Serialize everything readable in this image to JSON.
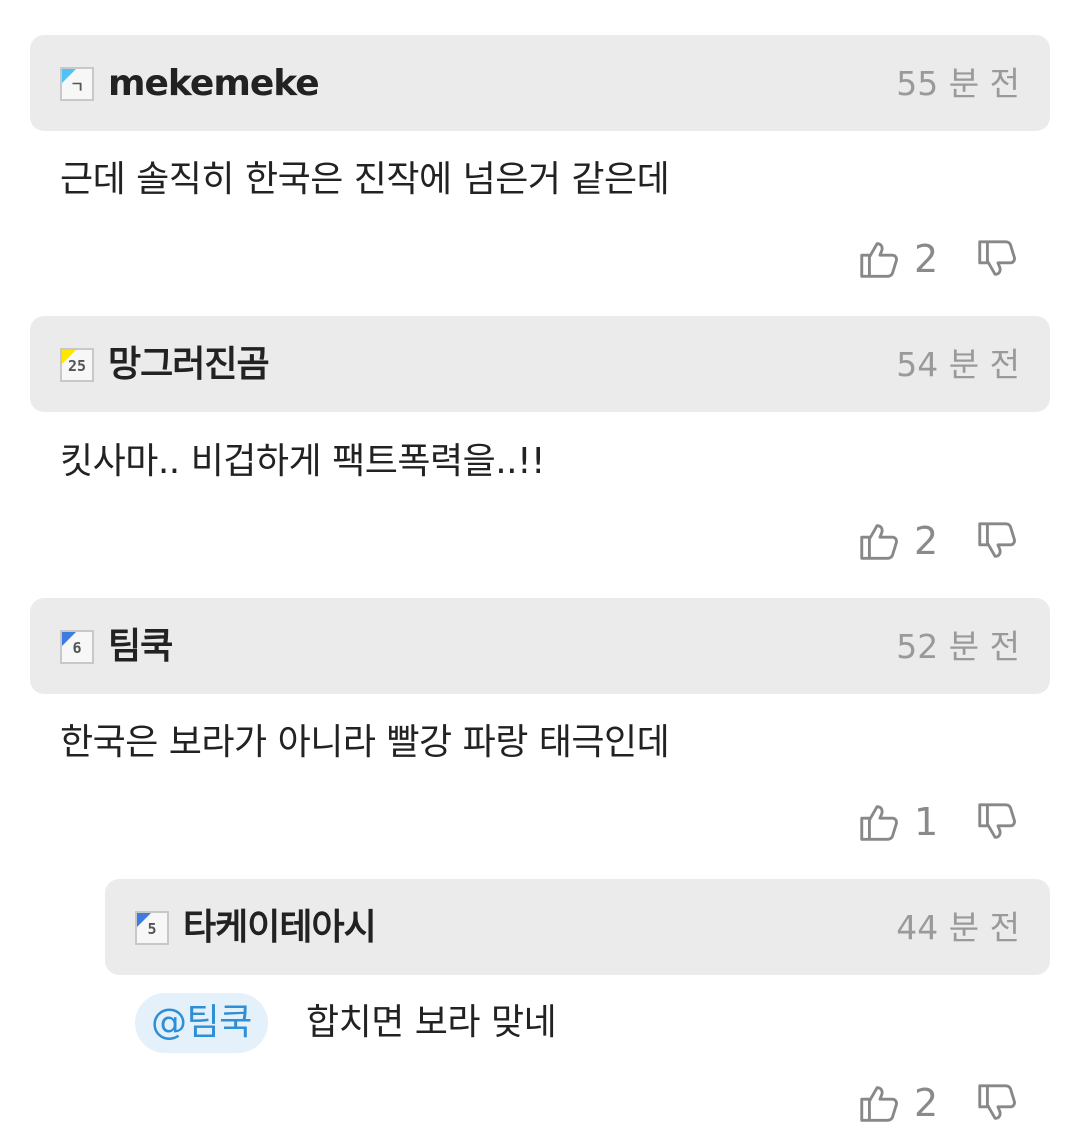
{
  "comments": [
    {
      "nickname": "mekemeke",
      "level": "ㄱ",
      "level_color": "#4fc3f7",
      "time": "55 분 전",
      "text": "근데 솔직히 한국은 진작에 넘은거 같은데",
      "likes": "2"
    },
    {
      "nickname": "망그러진곰",
      "level": "25",
      "level_color": "#ffe600",
      "time": "54 분 전",
      "text": "킷사마.. 비겁하게 팩트폭력을..!!",
      "likes": "2"
    },
    {
      "nickname": "팀쿡",
      "level": "6",
      "level_color": "#3d7be0",
      "time": "52 분 전",
      "text": "한국은 보라가 아니라 빨강 파랑 태극인데",
      "likes": "1"
    },
    {
      "nickname": "타케이테아시",
      "level": "5",
      "level_color": "#3d7be0",
      "time": "44 분 전",
      "mention": "@팀쿡",
      "text": "합치면 보라 맞네",
      "likes": "2"
    }
  ],
  "icons": {
    "like": "thumbs-up-icon",
    "dislike": "thumbs-down-icon"
  }
}
